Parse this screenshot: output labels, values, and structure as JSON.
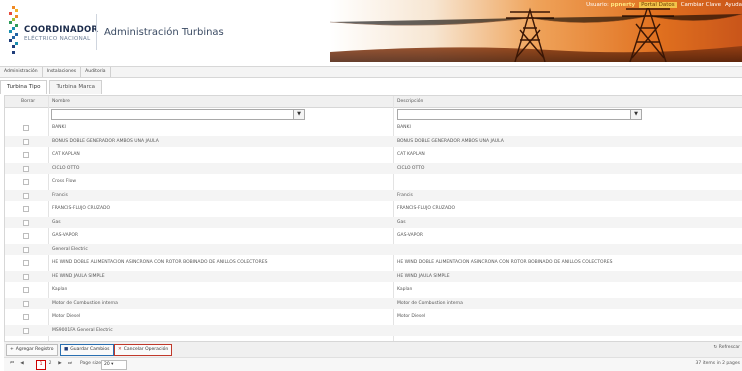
{
  "header": {
    "logo_line1": "COORDINADOR",
    "logo_line2": "ELÉCTRICO NACIONAL",
    "app_title": "Administración Turbinas"
  },
  "topnav": {
    "user_label": "Usuario:",
    "user_name": "ppnerty",
    "item2": "Portal Datos",
    "item3": "Cambiar Clave",
    "item4": "Ayuda"
  },
  "menubar": [
    "Administración",
    "Instalaciones",
    "Auditoría"
  ],
  "tabs": [
    "Turbina Tipo",
    "Turbina Marca"
  ],
  "grid": {
    "col_delete": "Borrar",
    "col_name": "Nombre",
    "col_desc": "Descripción",
    "rows": [
      {
        "name": "BANKI",
        "desc": "BANKI"
      },
      {
        "name": "BONUS DOBLE GENERADOR AMBOS UNA JAULA",
        "desc": "BONUS DOBLE GENERADOR AMBOS UNA JAULA"
      },
      {
        "name": "CAT KAPLAN",
        "desc": "CAT KAPLAN"
      },
      {
        "name": "CICLO OTTO",
        "desc": "CICLO OTTO"
      },
      {
        "name": "Cross Flow",
        "desc": ""
      },
      {
        "name": "Francis",
        "desc": "Francis"
      },
      {
        "name": "FRANCIS-FLUJO CRUZADO",
        "desc": "FRANCIS-FLUJO CRUZADO"
      },
      {
        "name": "Gas",
        "desc": "Gas"
      },
      {
        "name": "GAS-VAPOR",
        "desc": "GAS-VAPOR"
      },
      {
        "name": "General Electric",
        "desc": ""
      },
      {
        "name": "HE WIND DOBLE ALIMENTACION ASINCRONA CON ROTOR BOBINADO DE ANILLOS COLECTORES",
        "desc": "HE WIND DOBLE ALIMENTACION ASINCRONA CON ROTOR BOBINADO DE ANILLOS COLECTORES"
      },
      {
        "name": "HE WIND JAULA SIMPLE",
        "desc": "HE WIND JAULA SIMPLE"
      },
      {
        "name": "Kaplan",
        "desc": "Kaplan"
      },
      {
        "name": "Motor de Combustion interna",
        "desc": "Motor de Combustion interna"
      },
      {
        "name": "Motor Diesel",
        "desc": "Motor Diesel"
      },
      {
        "name": "MS9001FA General Electric",
        "desc": ""
      }
    ]
  },
  "toolbar": {
    "add": "Agregar Registro",
    "save": "Guardar Cambios",
    "cancel": "Cancelar Operación",
    "refresh": "Refrescar"
  },
  "pager": {
    "current_page": "1",
    "next_page": "2",
    "page_size_label": "Page size:",
    "page_size_value": "20",
    "info": "37 items in 2 pages"
  },
  "colors": {
    "accent_red": "#c0392b",
    "banner_orange": "#e98a2b",
    "selected_page": "#cc0000"
  }
}
